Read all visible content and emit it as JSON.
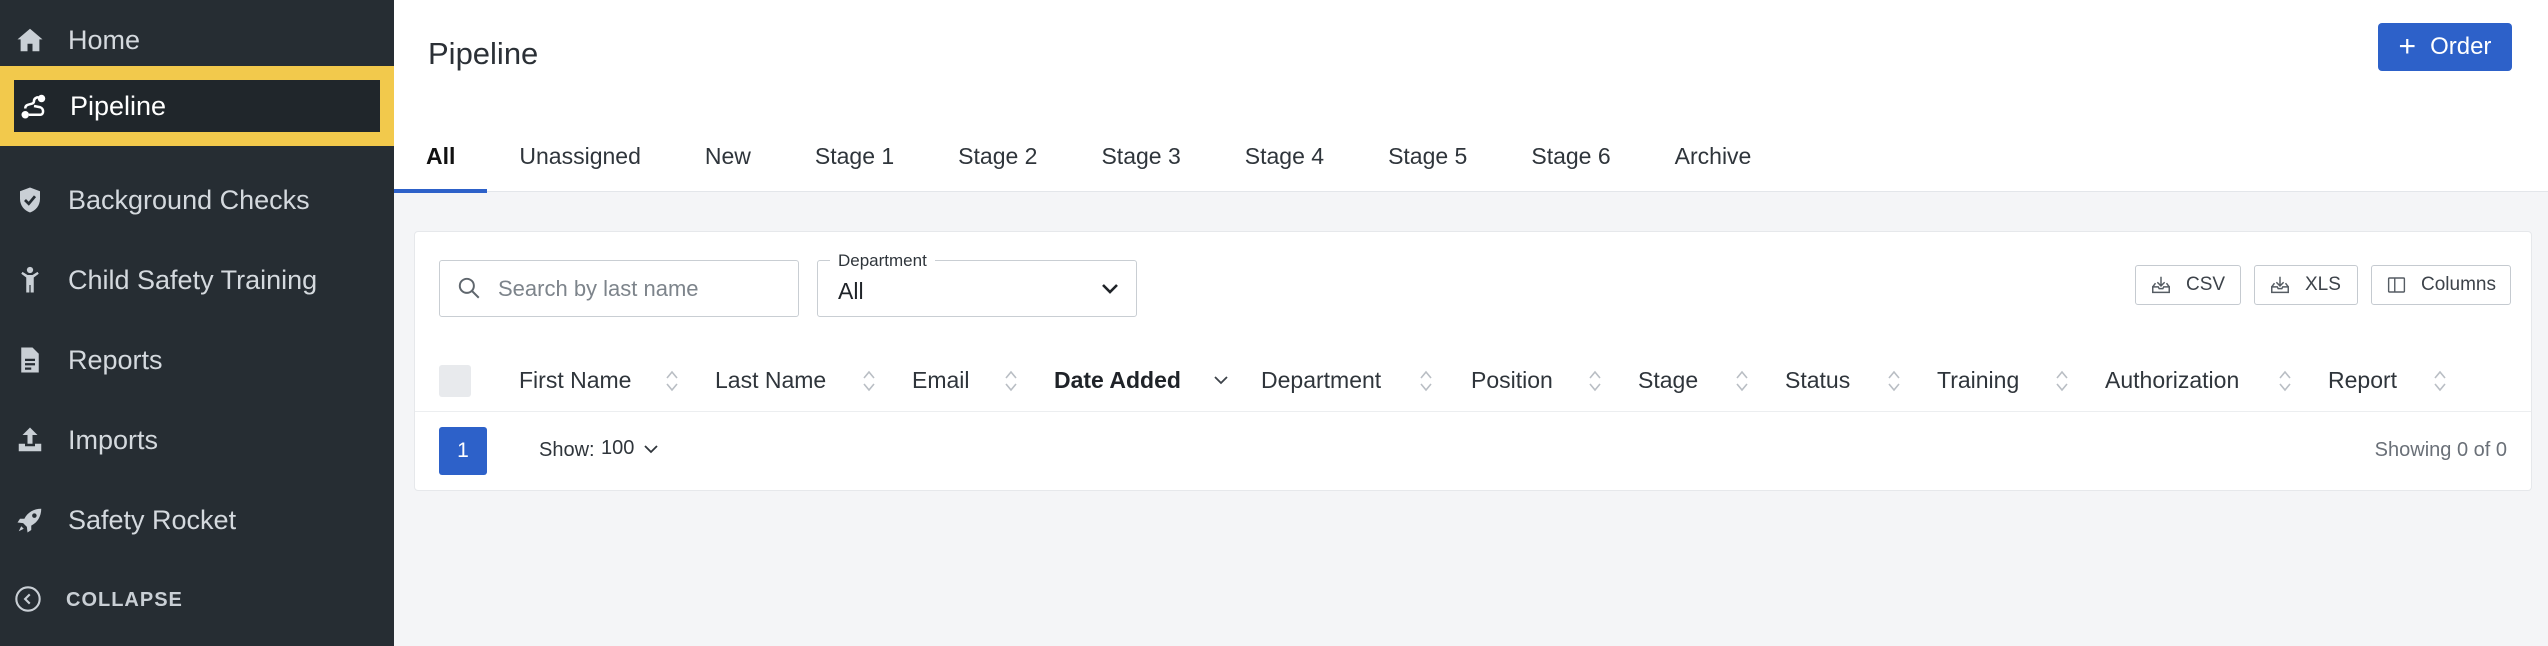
{
  "sidebar": {
    "items": [
      {
        "label": "Home",
        "icon": "home-icon"
      },
      {
        "label": "Pipeline",
        "icon": "pipeline-icon"
      },
      {
        "label": "Background Checks",
        "icon": "shield-icon"
      },
      {
        "label": "Child Safety Training",
        "icon": "child-icon"
      },
      {
        "label": "Reports",
        "icon": "document-icon"
      },
      {
        "label": "Imports",
        "icon": "upload-icon"
      },
      {
        "label": "Safety Rocket",
        "icon": "rocket-icon"
      }
    ],
    "active": "Pipeline",
    "collapse_label": "COLLAPSE"
  },
  "header": {
    "title": "Pipeline",
    "order_button": "Order",
    "tabs": [
      "All",
      "Unassigned",
      "New",
      "Stage 1",
      "Stage 2",
      "Stage 3",
      "Stage 4",
      "Stage 5",
      "Stage 6",
      "Archive"
    ],
    "active_tab": "All"
  },
  "filters": {
    "search_placeholder": "Search by last name",
    "department_label": "Department",
    "department_value": "All"
  },
  "toolbar": {
    "csv": "CSV",
    "xls": "XLS",
    "columns": "Columns"
  },
  "table": {
    "columns": [
      "First Name",
      "Last Name",
      "Email",
      "Date Added",
      "Department",
      "Position",
      "Stage",
      "Status",
      "Training",
      "Authorization",
      "Report"
    ],
    "sorted_column": "Date Added"
  },
  "pagination": {
    "page": "1",
    "show_label": "Show:",
    "show_value": "100",
    "showing_text": "Showing 0 of 0"
  },
  "colors": {
    "sidebar_bg": "#262d33",
    "active_highlight": "#f2c94c",
    "primary": "#2d61c9"
  }
}
